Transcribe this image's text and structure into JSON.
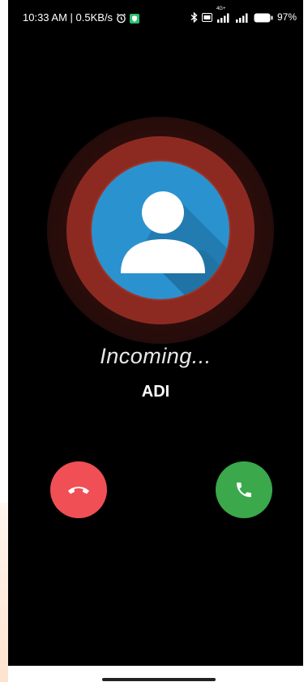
{
  "status_bar": {
    "time_speed": "10:33 AM | 0.5KB/s",
    "battery": "97%",
    "network_type": "4G+",
    "icons": {
      "alarm": "alarm-icon",
      "vpn": "shield-icon",
      "bluetooth": "bluetooth-icon",
      "volte": "volte-icon",
      "signal1": "signal-icon",
      "signal2": "signal-icon",
      "battery": "battery-icon"
    }
  },
  "call": {
    "status": "Incoming...",
    "caller": "ADI"
  },
  "actions": {
    "decline_icon": "phone-hangup-icon",
    "accept_icon": "phone-icon"
  },
  "colors": {
    "background": "#000000",
    "avatar": "#2a93cf",
    "ring": "#8c2a22",
    "decline": "#ef4f55",
    "accept": "#3aa84b"
  }
}
